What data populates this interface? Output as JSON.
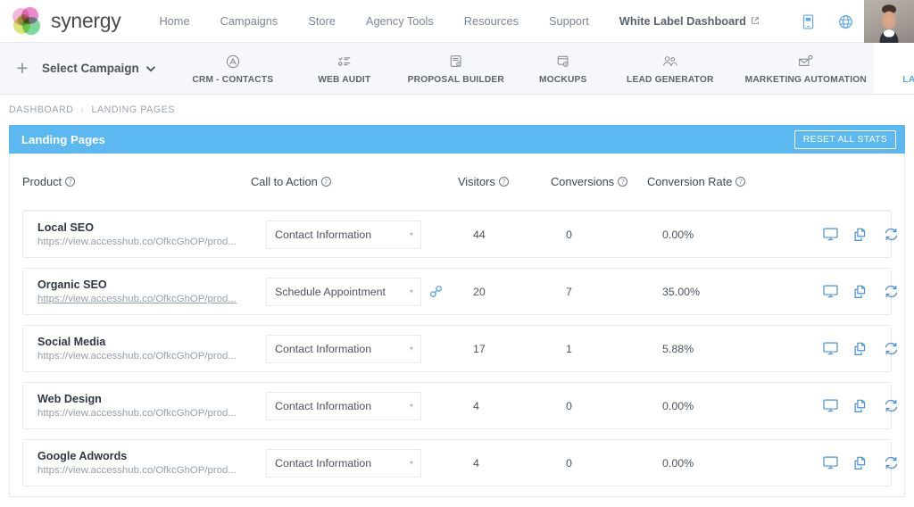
{
  "header": {
    "brand": "synergy",
    "nav": [
      {
        "label": "Home",
        "bold": false,
        "external": false
      },
      {
        "label": "Campaigns",
        "bold": false,
        "external": false
      },
      {
        "label": "Store",
        "bold": false,
        "external": false
      },
      {
        "label": "Agency Tools",
        "bold": false,
        "external": false
      },
      {
        "label": "Resources",
        "bold": false,
        "external": false
      },
      {
        "label": "Support",
        "bold": false,
        "external": false
      },
      {
        "label": "White Label Dashboard",
        "bold": true,
        "external": true
      }
    ],
    "right_icons": [
      {
        "name": "mobile-preview-icon"
      },
      {
        "name": "globe-icon"
      }
    ],
    "avatar_name": "user-avatar"
  },
  "toolbar": {
    "add_label": "+",
    "campaign_select_label": "Select Campaign",
    "tools": [
      {
        "label": "CRM - CONTACTS",
        "icon": "crm-contacts-icon",
        "active": false,
        "width": "wide"
      },
      {
        "label": "WEB AUDIT",
        "icon": "web-audit-icon",
        "active": false,
        "width": "normal"
      },
      {
        "label": "PROPOSAL BUILDER",
        "icon": "proposal-builder-icon",
        "active": false,
        "width": "wide"
      },
      {
        "label": "MOCKUPS",
        "icon": "mockups-icon",
        "active": false,
        "width": "narrow"
      },
      {
        "label": "LEAD GENERATOR",
        "icon": "lead-generator-icon",
        "active": false,
        "width": "wide"
      },
      {
        "label": "MARKETING AUTOMATION",
        "icon": "marketing-automation-icon",
        "active": false,
        "width": "wide"
      },
      {
        "label": "LANDING PAGES",
        "icon": "landing-pages-icon",
        "active": true,
        "width": "wide"
      }
    ]
  },
  "breadcrumb": {
    "root": "DASHBOARD",
    "separator": "›",
    "current": "LANDING PAGES"
  },
  "panel": {
    "title": "Landing Pages",
    "reset_button": "RESET ALL STATS",
    "accent_color": "#5cb8f0"
  },
  "table": {
    "columns": [
      {
        "label": "Product",
        "help": true
      },
      {
        "label": "Call to Action",
        "help": true
      },
      {
        "label": "Visitors",
        "help": true
      },
      {
        "label": "Conversions",
        "help": true
      },
      {
        "label": "Conversion Rate",
        "help": true
      }
    ],
    "help_glyph": "?",
    "caret_glyph": "▾",
    "rows": [
      {
        "product": "Local SEO",
        "url": "https://view.accesshub.co/OfkcGhOP/prod...",
        "url_linked": false,
        "cta": "Contact Information",
        "has_link_icon": false,
        "visitors": "44",
        "conversions": "0",
        "conversion_rate": "0.00%"
      },
      {
        "product": "Organic SEO",
        "url": "https://view.accesshub.co/OfkcGhOP/prod...",
        "url_linked": true,
        "cta": "Schedule Appointment",
        "has_link_icon": true,
        "visitors": "20",
        "conversions": "7",
        "conversion_rate": "35.00%"
      },
      {
        "product": "Social Media",
        "url": "https://view.accesshub.co/OfkcGhOP/prod...",
        "url_linked": false,
        "cta": "Contact Information",
        "has_link_icon": false,
        "visitors": "17",
        "conversions": "1",
        "conversion_rate": "5.88%"
      },
      {
        "product": "Web Design",
        "url": "https://view.accesshub.co/OfkcGhOP/prod...",
        "url_linked": false,
        "cta": "Contact Information",
        "has_link_icon": false,
        "visitors": "4",
        "conversions": "0",
        "conversion_rate": "0.00%"
      },
      {
        "product": "Google Adwords",
        "url": "https://view.accesshub.co/OfkcGhOP/prod...",
        "url_linked": false,
        "cta": "Contact Information",
        "has_link_icon": false,
        "visitors": "4",
        "conversions": "0",
        "conversion_rate": "0.00%"
      }
    ],
    "row_actions": [
      {
        "name": "preview-monitor-icon"
      },
      {
        "name": "duplicate-icon"
      },
      {
        "name": "reset-stats-icon"
      }
    ]
  }
}
